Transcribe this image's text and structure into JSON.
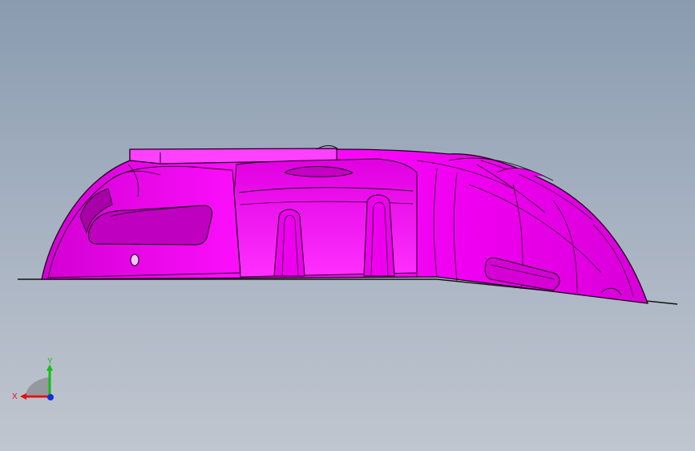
{
  "viewport": {
    "background_top": "#8a9bb0",
    "background_bottom": "#c0c6cf"
  },
  "model": {
    "fill_color": "#ff00ff",
    "shade_color": "#c400c4",
    "highlight_color": "#ff7bff",
    "edge_color": "#1a001a"
  },
  "triad": {
    "x_label": "X",
    "y_label": "Y",
    "x_color": "#e01010",
    "y_color": "#10c010",
    "z_color": "#1030e0"
  }
}
